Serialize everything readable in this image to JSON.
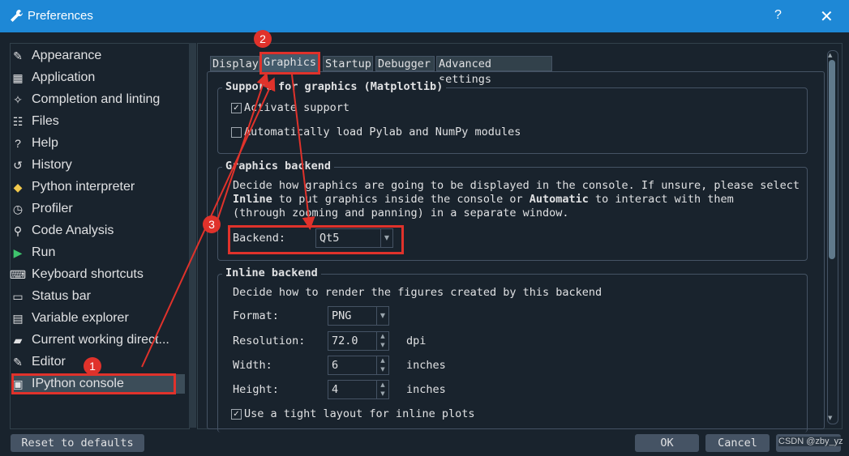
{
  "window": {
    "title": "Preferences",
    "help_glyph": "?",
    "close_glyph": "✕"
  },
  "sidebar": {
    "items": [
      {
        "label": "Appearance",
        "icon": "paint-brush-icon"
      },
      {
        "label": "Application",
        "icon": "application-grid-icon"
      },
      {
        "label": "Completion and linting",
        "icon": "completion-icon"
      },
      {
        "label": "Files",
        "icon": "files-icon"
      },
      {
        "label": "Help",
        "icon": "help-icon"
      },
      {
        "label": "History",
        "icon": "history-icon"
      },
      {
        "label": "Python interpreter",
        "icon": "python-icon"
      },
      {
        "label": "Profiler",
        "icon": "profiler-icon"
      },
      {
        "label": "Code Analysis",
        "icon": "code-analysis-icon"
      },
      {
        "label": "Run",
        "icon": "run-icon"
      },
      {
        "label": "Keyboard shortcuts",
        "icon": "keyboard-icon"
      },
      {
        "label": "Status bar",
        "icon": "status-bar-icon"
      },
      {
        "label": "Variable explorer",
        "icon": "variable-explorer-icon"
      },
      {
        "label": "Current working direct...",
        "icon": "folder-icon"
      },
      {
        "label": "Editor",
        "icon": "editor-icon"
      },
      {
        "label": "IPython console",
        "icon": "ipython-console-icon",
        "selected": true
      }
    ]
  },
  "tabs": [
    "Display",
    "Graphics",
    "Startup",
    "Debugger",
    "Advanced settings"
  ],
  "support_group": {
    "title": "Support for graphics (Matplotlib)",
    "activate_label": "Activate support",
    "activate_checked": true,
    "pylab_label": "Automatically load Pylab and NumPy modules",
    "pylab_checked": false
  },
  "backend_group": {
    "title": "Graphics backend",
    "desc_line1": "Decide how graphics are going to be displayed in the console. If unsure, please select",
    "desc_line2_b1": "Inline",
    "desc_line2_t1": " to put graphics inside the console or ",
    "desc_line2_b2": "Automatic",
    "desc_line2_t2": " to interact with them",
    "desc_line3": "(through zooming and panning) in a separate window.",
    "backend_label": "Backend:",
    "backend_value": "Qt5"
  },
  "inline_group": {
    "title": "Inline backend",
    "desc": "Decide how to render the figures created by this backend",
    "format_label": "Format:",
    "format_value": "PNG",
    "resolution_label": "Resolution:",
    "resolution_value": "72.0",
    "resolution_unit": "dpi",
    "width_label": "Width:",
    "width_value": "6",
    "width_unit": "inches",
    "height_label": "Height:",
    "height_value": "4",
    "height_unit": "inches",
    "tight_label": "Use a tight layout for inline plots",
    "tight_checked": true
  },
  "footer": {
    "reset": "Reset to defaults",
    "ok": "OK",
    "cancel": "Cancel"
  },
  "annotations": {
    "badge1": "1",
    "badge2": "2",
    "badge3": "3",
    "color": "#e0322b"
  },
  "watermark": "CSDN @zby_yz"
}
